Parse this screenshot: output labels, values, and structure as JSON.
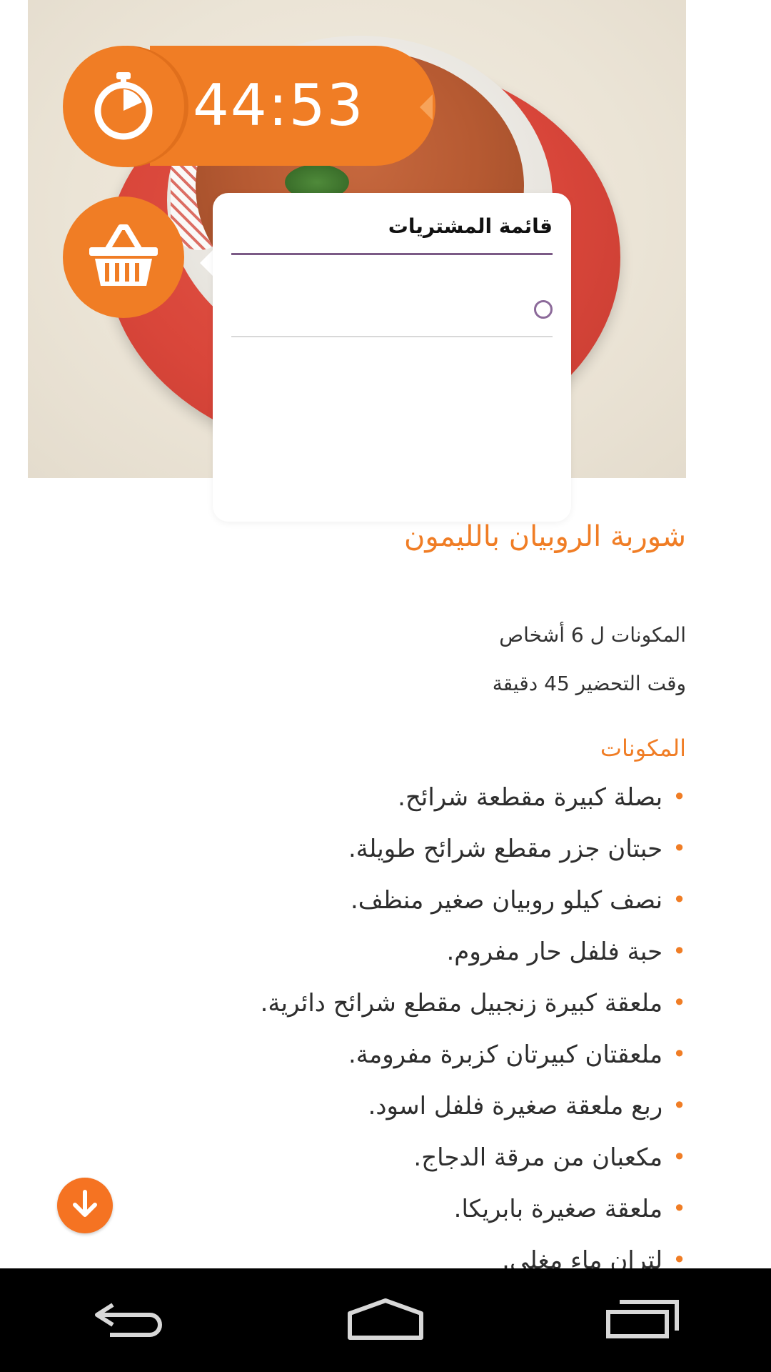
{
  "timer": {
    "value": "44:53"
  },
  "shopping_list": {
    "title": "قائمة المشتريات"
  },
  "recipe": {
    "title": "شوربة الروبيان بالليمون",
    "servings": "المكونات ل 6 أشخاص",
    "prep_time": "وقت التحضير 45 دقيقة",
    "ingredients_heading": "المكونات",
    "ingredients": [
      "بصلة كبيرة مقطعة شرائح.",
      "حبتان جزر مقطع شرائح طويلة.",
      "نصف كيلو روبيان صغير منظف.",
      "حبة فلفل حار مفروم.",
      "ملعقة كبيرة زنجبيل مقطع شرائح دائرية.",
      "ملعقتان كبيرتان كزبرة مفرومة.",
      "ربع ملعقة صغيرة فلفل اسود.",
      "مكعبان من مرقة الدجاج.",
      "ملعقة صغيرة بابريكا.",
      "لتران ماء مغلي."
    ]
  },
  "colors": {
    "accent": "#f07d25",
    "popup_divider": "#7b5a86",
    "nav_bg": "#000000"
  },
  "icons": {
    "timer": "stopwatch-icon",
    "basket": "basket-icon",
    "down": "arrow-down-icon",
    "back": "back-icon",
    "home": "home-icon",
    "recents": "recents-icon"
  }
}
